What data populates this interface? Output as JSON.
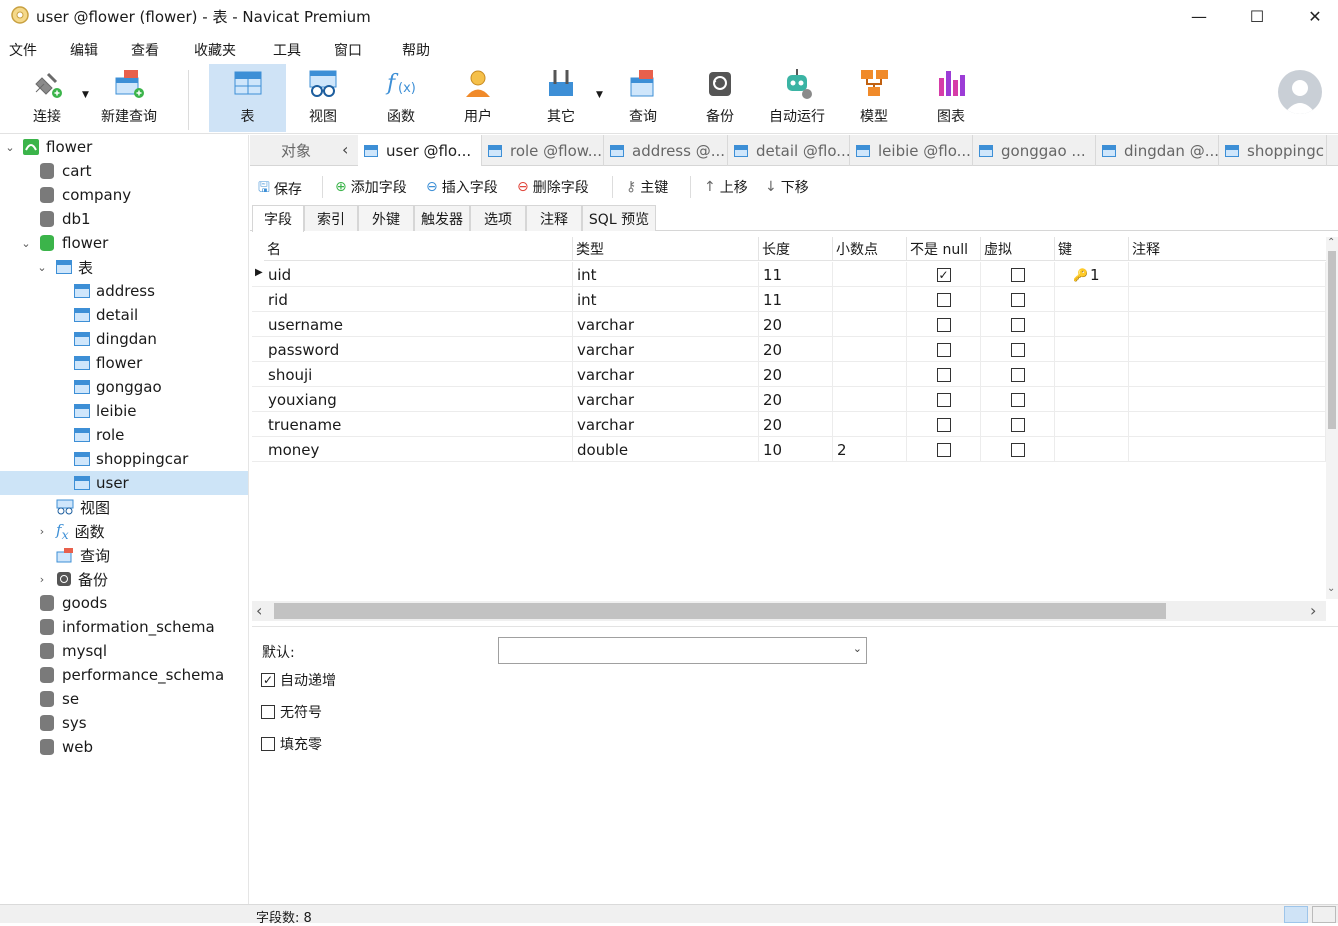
{
  "window": {
    "title": "user @flower (flower) - 表 - Navicat Premium"
  },
  "menu": [
    "文件",
    "编辑",
    "查看",
    "收藏夹",
    "工具",
    "窗口",
    "帮助"
  ],
  "toolbar": {
    "connect": "连接",
    "new_query": "新建查询",
    "table": "表",
    "view": "视图",
    "function": "函数",
    "user": "用户",
    "other": "其它",
    "query": "查询",
    "backup": "备份",
    "automation": "自动运行",
    "model": "模型",
    "chart": "图表"
  },
  "tree": {
    "root": "flower",
    "databases_top": [
      "cart",
      "company",
      "db1"
    ],
    "open_db": "flower",
    "tables_node": "表",
    "tables": [
      "address",
      "detail",
      "dingdan",
      "flower",
      "gonggao",
      "leibie",
      "role",
      "shoppingcar",
      "user"
    ],
    "selected_table": "user",
    "sub_nodes": {
      "views": "视图",
      "functions": "函数",
      "queries": "查询",
      "backups": "备份"
    },
    "databases_bottom": [
      "goods",
      "information_schema",
      "mysql",
      "performance_schema",
      "se",
      "sys",
      "web"
    ]
  },
  "tabs": {
    "objects": "对象",
    "open": [
      "user @flo...",
      "role @flow...",
      "address @...",
      "detail @flo...",
      "leibie @flo...",
      "gonggao ...",
      "dingdan @...",
      "shoppingc"
    ]
  },
  "field_toolbar": {
    "save": "保存",
    "add_field": "添加字段",
    "insert_field": "插入字段",
    "delete_field": "删除字段",
    "primary_key": "主键",
    "move_up": "上移",
    "move_down": "下移"
  },
  "subtabs": [
    "字段",
    "索引",
    "外键",
    "触发器",
    "选项",
    "注释",
    "SQL 预览"
  ],
  "grid": {
    "headers": {
      "name": "名",
      "type": "类型",
      "length": "长度",
      "decimals": "小数点",
      "not_null": "不是 null",
      "virtual": "虚拟",
      "key": "键",
      "comment": "注释"
    },
    "rows": [
      {
        "name": "uid",
        "type": "int",
        "length": "11",
        "decimals": "",
        "not_null": true,
        "virtual": false,
        "key": "1",
        "current": true
      },
      {
        "name": "rid",
        "type": "int",
        "length": "11",
        "decimals": "",
        "not_null": false,
        "virtual": false,
        "key": ""
      },
      {
        "name": "username",
        "type": "varchar",
        "length": "20",
        "decimals": "",
        "not_null": false,
        "virtual": false,
        "key": ""
      },
      {
        "name": "password",
        "type": "varchar",
        "length": "20",
        "decimals": "",
        "not_null": false,
        "virtual": false,
        "key": ""
      },
      {
        "name": "shouji",
        "type": "varchar",
        "length": "20",
        "decimals": "",
        "not_null": false,
        "virtual": false,
        "key": ""
      },
      {
        "name": "youxiang",
        "type": "varchar",
        "length": "20",
        "decimals": "",
        "not_null": false,
        "virtual": false,
        "key": ""
      },
      {
        "name": "truename",
        "type": "varchar",
        "length": "20",
        "decimals": "",
        "not_null": false,
        "virtual": false,
        "key": ""
      },
      {
        "name": "money",
        "type": "double",
        "length": "10",
        "decimals": "2",
        "not_null": false,
        "virtual": false,
        "key": ""
      }
    ]
  },
  "props": {
    "default_label": "默认:",
    "auto_increment": {
      "label": "自动递增",
      "checked": true
    },
    "unsigned": {
      "label": "无符号",
      "checked": false
    },
    "zerofill": {
      "label": "填充零",
      "checked": false
    }
  },
  "status": {
    "field_count": "字段数: 8"
  },
  "colors": {
    "accent": "#3d8fd6",
    "selection": "#cde4f7",
    "toolbar_active": "#cfe3f6"
  }
}
